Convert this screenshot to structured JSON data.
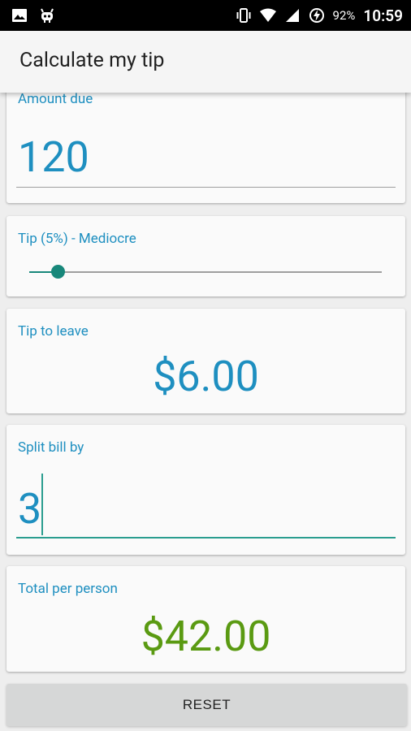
{
  "status_bar": {
    "battery_percent": "92%",
    "time": "10:59"
  },
  "app_bar": {
    "title": "Calculate my tip"
  },
  "amount_due": {
    "label": "Amount due",
    "value": "120"
  },
  "tip": {
    "label": "Tip (5%) - Mediocre",
    "slider_fraction": 0.08
  },
  "tip_to_leave": {
    "label": "Tip to leave",
    "value": "$6.00"
  },
  "split_bill": {
    "label": "Split bill by",
    "value": "3"
  },
  "total_per_person": {
    "label": "Total per person",
    "value": "$42.00"
  },
  "reset_button": {
    "label": "RESET"
  },
  "colors": {
    "accent_blue": "#1e8fc0",
    "teal": "#17877a",
    "total_green": "#5a9a12"
  }
}
